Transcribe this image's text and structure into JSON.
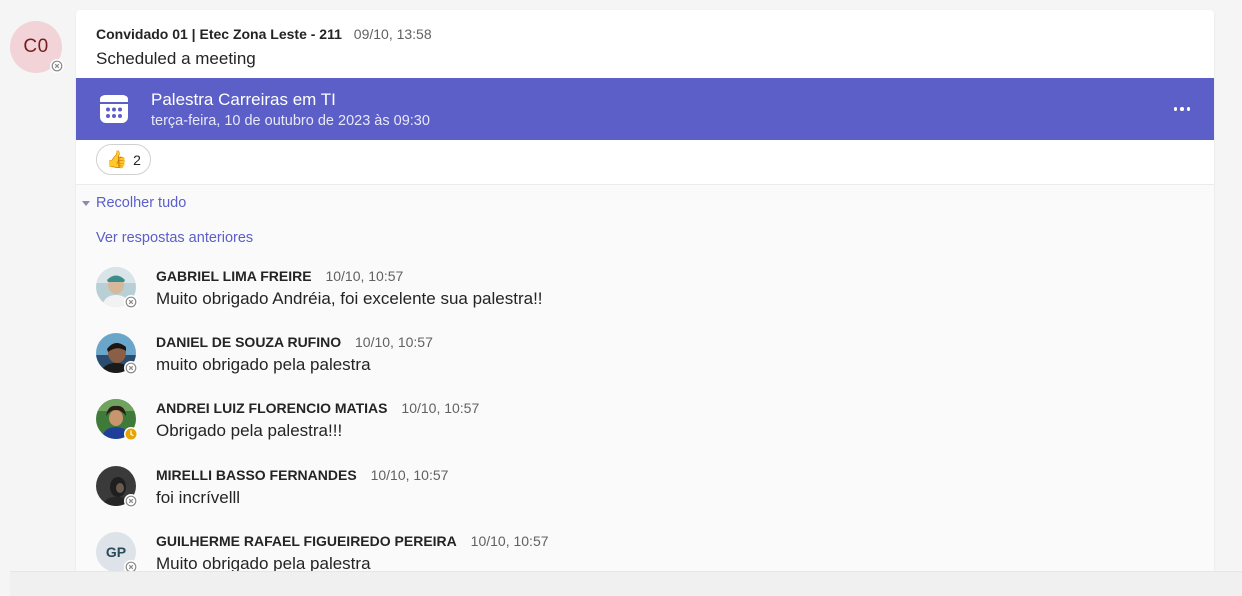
{
  "post": {
    "avatar_initials": "C0",
    "author": "Convidado 01 | Etec Zona Leste - 211",
    "timestamp": "09/10, 13:58",
    "text": "Scheduled a meeting"
  },
  "meeting": {
    "title": "Palestra Carreiras em TI",
    "date": "terça-feira, 10 de outubro de 2023 às 09:30",
    "banner_color": "#5b5fc7"
  },
  "reaction": {
    "emoji": "👍",
    "count": "2"
  },
  "replies_section": {
    "collapse_label": "Recolher tudo",
    "earlier_label": "Ver respostas anteriores"
  },
  "replies": [
    {
      "author": "GABRIEL LIMA FREIRE",
      "time": "10/10, 10:57",
      "text": "Muito obrigado Andréia, foi excelente sua palestra!!",
      "presence": "offline"
    },
    {
      "author": "DANIEL DE SOUZA RUFINO",
      "time": "10/10, 10:57",
      "text": "muito obrigado pela palestra",
      "presence": "offline"
    },
    {
      "author": "ANDREI LUIZ FLORENCIO MATIAS",
      "time": "10/10, 10:57",
      "text": "Obrigado pela palestra!!!",
      "presence": "away"
    },
    {
      "author": "MIRELLI BASSO FERNANDES",
      "time": "10/10, 10:57",
      "text": "foi incrívelll",
      "presence": "offline"
    },
    {
      "author": "GUILHERME RAFAEL FIGUEIREDO PEREIRA",
      "time": "10/10, 10:57",
      "text": "Muito obrigado pela palestra",
      "presence": "offline",
      "initials": "GP"
    }
  ],
  "colors": {
    "accent": "#5b5fc7",
    "away": "#eaa300",
    "offline": "#8a8a8a"
  }
}
